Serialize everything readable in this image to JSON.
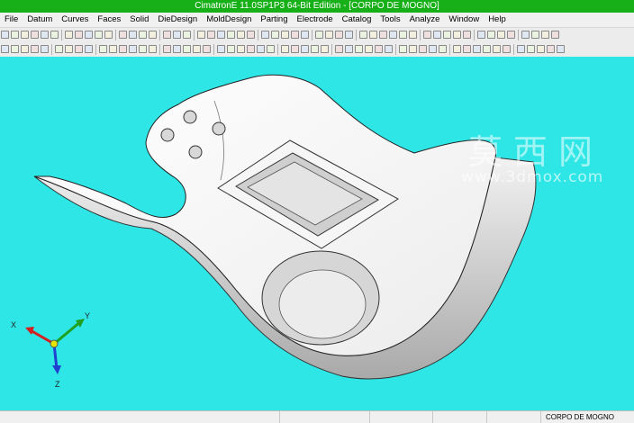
{
  "window": {
    "title": "CimatronE 11.0SP1P3 64-Bit Edition - [CORPO DE MOGNO]"
  },
  "menu": [
    "File",
    "Datum",
    "Curves",
    "Faces",
    "Solid",
    "DieDesign",
    "MoldDesign",
    "Parting",
    "Electrode",
    "Catalog",
    "Tools",
    "Analyze",
    "Window",
    "Help"
  ],
  "colors": {
    "title_bar": "#18b018",
    "viewport_background": "#2ee6e6",
    "axis_x": "#d42020",
    "axis_y": "#20a020",
    "axis_z": "#2040d0"
  },
  "watermark": {
    "chinese": "莫西网",
    "url": "www.3dmox.com"
  },
  "axes": {
    "x": "X",
    "y": "Y",
    "z": "Z"
  },
  "status": {
    "filename": "CORPO DE MOGNO"
  }
}
